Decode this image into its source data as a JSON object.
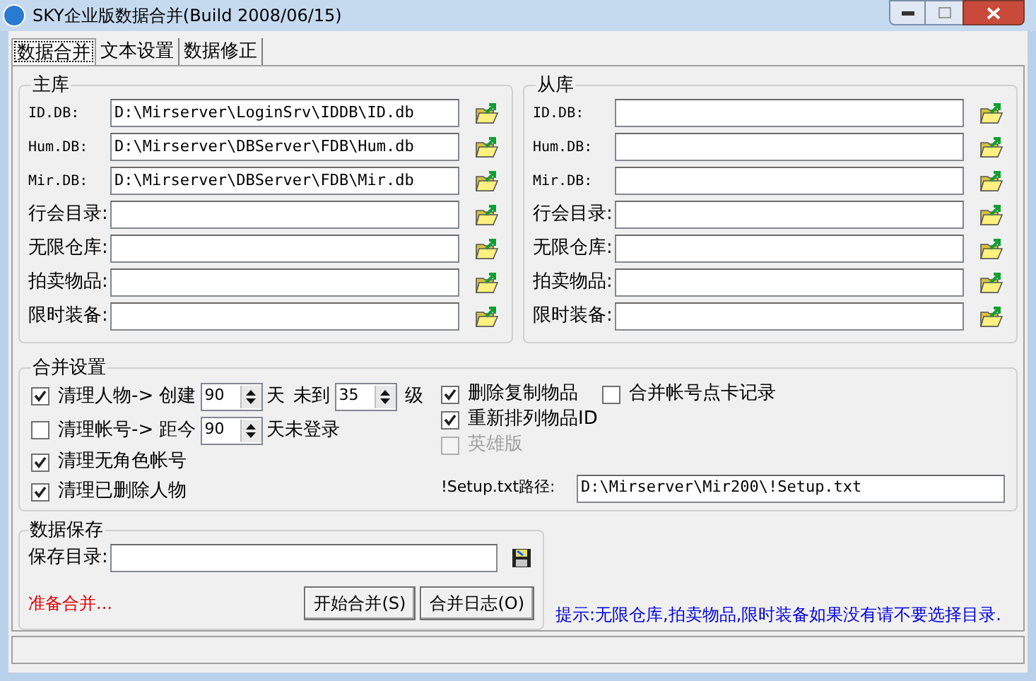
{
  "window": {
    "title": "SKY企业版数据合并(Build 2008/06/15)"
  },
  "tabs": [
    {
      "label": "数据合并",
      "selected": true
    },
    {
      "label": "文本设置",
      "selected": false
    },
    {
      "label": "数据修正",
      "selected": false
    }
  ],
  "main_db": {
    "title": "主库",
    "fields": [
      {
        "label": "ID.DB:",
        "kind": "mono",
        "value": "D:\\Mirserver\\LoginSrv\\IDDB\\ID.db"
      },
      {
        "label": "Hum.DB:",
        "kind": "mono",
        "value": "D:\\Mirserver\\DBServer\\FDB\\Hum.db"
      },
      {
        "label": "Mir.DB:",
        "kind": "mono",
        "value": "D:\\Mirserver\\DBServer\\FDB\\Mir.db"
      },
      {
        "label": "行会目录:",
        "kind": "cjk"
      },
      {
        "label": "无限仓库:",
        "kind": "cjk"
      },
      {
        "label": "拍卖物品:",
        "kind": "cjk"
      },
      {
        "label": "限时装备:",
        "kind": "cjk"
      }
    ]
  },
  "slave_db": {
    "title": "从库",
    "fields": [
      {
        "label": "ID.DB:",
        "kind": "mono"
      },
      {
        "label": "Hum.DB:",
        "kind": "mono"
      },
      {
        "label": "Mir.DB:",
        "kind": "mono"
      },
      {
        "label": "行会目录:",
        "kind": "cjk"
      },
      {
        "label": "无限仓库:",
        "kind": "cjk"
      },
      {
        "label": "拍卖物品:",
        "kind": "cjk"
      },
      {
        "label": "限时装备:",
        "kind": "cjk"
      }
    ]
  },
  "merge_settings": {
    "title": "合并设置",
    "clean_characters": {
      "label": "清理人物-> 创建",
      "checked": true,
      "days": "90",
      "days_unit": "天",
      "level_prefix": "未到",
      "level": "35",
      "level_unit": "级"
    },
    "clean_accounts": {
      "label": "清理帐号-> 距今",
      "checked": false,
      "days": "90",
      "days_unit": "天未登录"
    },
    "left_options": [
      {
        "label": "清理无角色帐号",
        "checked": true
      },
      {
        "label": "清理已删除人物",
        "checked": true
      }
    ],
    "right_options": [
      {
        "label": "删除复制物品",
        "checked": true,
        "disabled": false
      },
      {
        "label": "重新排列物品ID",
        "checked": true,
        "disabled": false
      },
      {
        "label": "英雄版",
        "checked": false,
        "disabled": true
      }
    ],
    "extra_option": {
      "label": "合并帐号点卡记录",
      "checked": false
    },
    "setup_path": {
      "label": "!Setup.txt路径:",
      "value": "D:\\Mirserver\\Mir200\\!Setup.txt"
    }
  },
  "data_save": {
    "title": "数据保存",
    "label": "保存目录:",
    "status": "准备合并...",
    "buttons": [
      "开始合并(S)",
      "合并日志(O)"
    ]
  },
  "hint": "提示:无限仓库,拍卖物品,限时装备如果没有请不要选择目录."
}
